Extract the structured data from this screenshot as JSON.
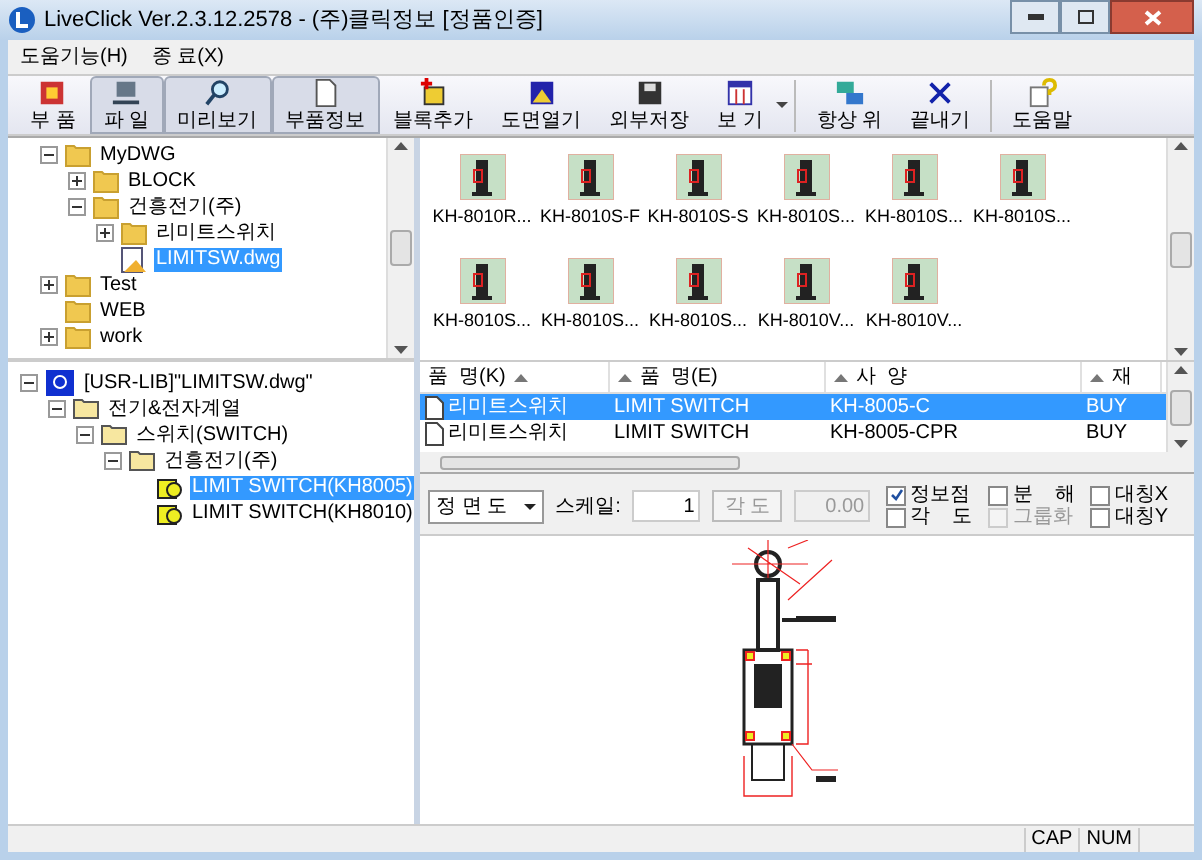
{
  "window": {
    "title": "LiveClick Ver.2.3.12.2578 - (주)클릭정보 [정품인증]"
  },
  "menu": [
    "도움기능(H)",
    "종 료(X)"
  ],
  "toolbar": [
    {
      "label": "부 품",
      "kind": "part",
      "selected": false
    },
    {
      "label": "파 일",
      "kind": "file",
      "selected": true
    },
    {
      "label": "미리보기",
      "kind": "preview",
      "selected": true
    },
    {
      "label": "부품정보",
      "kind": "info",
      "selected": true
    },
    {
      "label": "블록추가",
      "kind": "addblock",
      "selected": false
    },
    {
      "label": "도면열기",
      "kind": "open",
      "selected": false
    },
    {
      "label": "외부저장",
      "kind": "save",
      "selected": false
    },
    {
      "label": "보 기",
      "kind": "view",
      "selected": false
    },
    {
      "label": "항상 위",
      "kind": "ontop",
      "selected": false
    },
    {
      "label": "끝내기",
      "kind": "exit",
      "selected": false
    },
    {
      "label": "도움말",
      "kind": "help",
      "selected": false
    }
  ],
  "file_tree": [
    {
      "label": "MyDWG",
      "kind": "folder",
      "expanded": true,
      "selected": false,
      "children": [
        {
          "label": "BLOCK",
          "kind": "folder",
          "expanded": false,
          "selected": false
        },
        {
          "label": "건흥전기(주)",
          "kind": "folder",
          "expanded": true,
          "selected": false,
          "children": [
            {
              "label": "리미트스위치",
              "kind": "folder",
              "expanded": false,
              "selected": false
            },
            {
              "label": "LIMITSW.dwg",
              "kind": "file",
              "selected": true
            }
          ]
        }
      ]
    },
    {
      "label": "Test",
      "kind": "folder",
      "expanded": false,
      "selected": false
    },
    {
      "label": "WEB",
      "kind": "folder",
      "selected": false
    },
    {
      "label": "work",
      "kind": "folder",
      "expanded": false,
      "selected": false
    }
  ],
  "library_tree": [
    {
      "label": "[USR-LIB]\"LIMITSW.dwg\"",
      "kind": "library",
      "expanded": true,
      "selected": false,
      "children": [
        {
          "label": "전기&전자계열",
          "kind": "group",
          "expanded": true,
          "selected": false,
          "children": [
            {
              "label": "스위치(SWITCH)",
              "kind": "group",
              "expanded": true,
              "selected": false,
              "children": [
                {
                  "label": "건흥전기(주)",
                  "kind": "group",
                  "expanded": true,
                  "selected": false,
                  "children": [
                    {
                      "label": "LIMIT SWITCH(KH8005)",
                      "kind": "part",
                      "selected": true
                    },
                    {
                      "label": "LIMIT SWITCH(KH8010)",
                      "kind": "part",
                      "selected": false
                    }
                  ]
                }
              ]
            }
          ]
        }
      ]
    }
  ],
  "thumbnails": [
    "KH-8010R...",
    "KH-8010S-F",
    "KH-8010S-S",
    "KH-8010S...",
    "KH-8010S...",
    "KH-8010S...",
    "KH-8010S...",
    "KH-8010S...",
    "KH-8010S...",
    "KH-8010V...",
    "KH-8010V..."
  ],
  "table": {
    "columns": [
      "품  명(K)",
      "품  명(E)",
      "사  양",
      "재"
    ],
    "rows": [
      {
        "cells": [
          "리미트스위치",
          "LIMIT SWITCH",
          "KH-8005-C",
          "BUY"
        ],
        "selected": true
      },
      {
        "cells": [
          "리미트스위치",
          "LIMIT SWITCH",
          "KH-8005-CPR",
          "BUY"
        ],
        "selected": false
      }
    ]
  },
  "options": {
    "view": "정 면 도",
    "scale_label": "스케일:",
    "scale": "1",
    "angle_button": {
      "label": "각 도",
      "disabled": true
    },
    "angle": {
      "value": "0.00",
      "disabled": true
    },
    "checkboxes": [
      {
        "label": "정보점",
        "checked": true,
        "disabled": false
      },
      {
        "label": "각    도",
        "checked": false,
        "disabled": false
      },
      {
        "label": "분    해",
        "checked": false,
        "disabled": false
      },
      {
        "label": "그룹화",
        "checked": false,
        "disabled": true
      },
      {
        "label": "대칭X",
        "checked": false,
        "disabled": false
      },
      {
        "label": "대칭Y",
        "checked": false,
        "disabled": false
      }
    ]
  },
  "status_bar": [
    "CAP",
    "NUM"
  ]
}
